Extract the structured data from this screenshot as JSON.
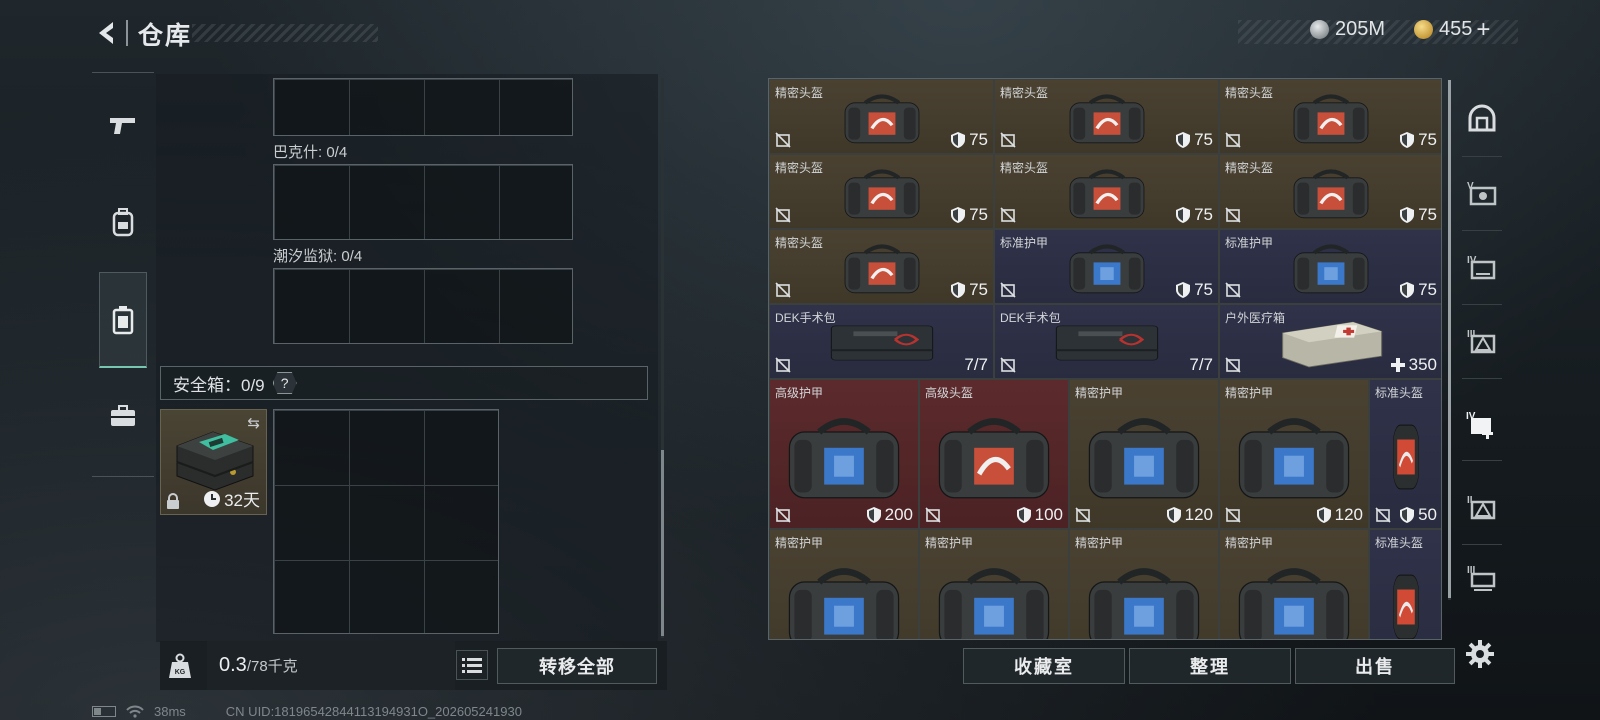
{
  "header": {
    "title": "仓库",
    "currency_silver": "205M",
    "currency_gold": "455",
    "currency_gold_plus": "+"
  },
  "left_nav": {
    "items": [
      {
        "icon": "pistol-icon"
      },
      {
        "icon": "backpack-icon"
      },
      {
        "icon": "vest-icon"
      },
      {
        "icon": "briefcase-icon"
      }
    ],
    "active_index": 2
  },
  "containers": [
    {
      "label": "巴克什: 0/4"
    },
    {
      "label": "潮汐监狱: 0/4"
    }
  ],
  "safebox": {
    "label": "安全箱：0/9",
    "help": "?",
    "duration": "32天"
  },
  "weight": {
    "value": "0.3",
    "max": "/78千克"
  },
  "actions": {
    "transfer_all": "转移全部",
    "collection": "收藏室",
    "organize": "整理",
    "sell": "出售"
  },
  "inventory": {
    "items": [
      {
        "name": "精密头盔",
        "value": "75",
        "kind": "helmet",
        "tier": "brown",
        "vtype": "shield"
      },
      {
        "name": "精密头盔",
        "value": "75",
        "kind": "helmet",
        "tier": "brown",
        "vtype": "shield"
      },
      {
        "name": "精密头盔",
        "value": "75",
        "kind": "helmet",
        "tier": "brown",
        "vtype": "shield"
      },
      {
        "name": "精密头盔",
        "value": "75",
        "kind": "helmet",
        "tier": "brown",
        "vtype": "shield"
      },
      {
        "name": "精密头盔",
        "value": "75",
        "kind": "helmet",
        "tier": "brown",
        "vtype": "shield"
      },
      {
        "name": "精密头盔",
        "value": "75",
        "kind": "helmet",
        "tier": "brown",
        "vtype": "shield"
      },
      {
        "name": "精密头盔",
        "value": "75",
        "kind": "helmet",
        "tier": "brown",
        "vtype": "shield"
      },
      {
        "name": "标准护甲",
        "value": "75",
        "kind": "armor",
        "tier": "navy",
        "vtype": "shield"
      },
      {
        "name": "标准护甲",
        "value": "75",
        "kind": "armor",
        "tier": "navy",
        "vtype": "shield"
      },
      {
        "name": "DEK手术包",
        "value": "7/7",
        "kind": "kit",
        "tier": "navy",
        "vtype": "count"
      },
      {
        "name": "DEK手术包",
        "value": "7/7",
        "kind": "kit",
        "tier": "navy",
        "vtype": "count"
      },
      {
        "name": "户外医疗箱",
        "value": "350",
        "kind": "medbox",
        "tier": "navy",
        "vtype": "heal"
      },
      {
        "name": "高级护甲",
        "value": "200",
        "kind": "armor-big",
        "tier": "red",
        "vtype": "shield"
      },
      {
        "name": "高级头盔",
        "value": "100",
        "kind": "helmet-big",
        "tier": "red",
        "vtype": "shield"
      },
      {
        "name": "精密护甲",
        "value": "120",
        "kind": "armor-big",
        "tier": "brown",
        "vtype": "shield"
      },
      {
        "name": "精密护甲",
        "value": "120",
        "kind": "armor-big",
        "tier": "brown",
        "vtype": "shield"
      },
      {
        "name": "标准头盔",
        "value": "50",
        "kind": "helmet-slim",
        "tier": "navy",
        "vtype": "shield"
      },
      {
        "name": "精密护甲",
        "value": "",
        "kind": "armor-big",
        "tier": "brown",
        "vtype": "shield"
      },
      {
        "name": "精密护甲",
        "value": "",
        "kind": "armor-big",
        "tier": "brown",
        "vtype": "shield"
      },
      {
        "name": "精密护甲",
        "value": "",
        "kind": "armor-big",
        "tier": "brown",
        "vtype": "shield"
      },
      {
        "name": "精密护甲",
        "value": "",
        "kind": "armor-big",
        "tier": "brown",
        "vtype": "shield"
      },
      {
        "name": "标准头盔",
        "value": "",
        "kind": "helmet-slim",
        "tier": "navy",
        "vtype": "shield"
      }
    ]
  },
  "right_rail": {
    "items": [
      {
        "icon": "dome-icon"
      },
      {
        "icon": "tier-v-icon"
      },
      {
        "icon": "tier-iv-icon"
      },
      {
        "icon": "tier-iii-icon"
      },
      {
        "icon": "tier-iv-plus-icon"
      },
      {
        "icon": "tier-ii-icon"
      },
      {
        "icon": "tier-iii-bottom-icon"
      }
    ],
    "active_index": 4
  },
  "status": {
    "ping": "38ms",
    "uid": "CN UID:18196542844113194931O_202605241930"
  },
  "colors": {
    "accent": "#79c6b0",
    "tier_brown": "#4a4131",
    "tier_navy": "#30324a",
    "tier_red": "#5c2a2c"
  }
}
